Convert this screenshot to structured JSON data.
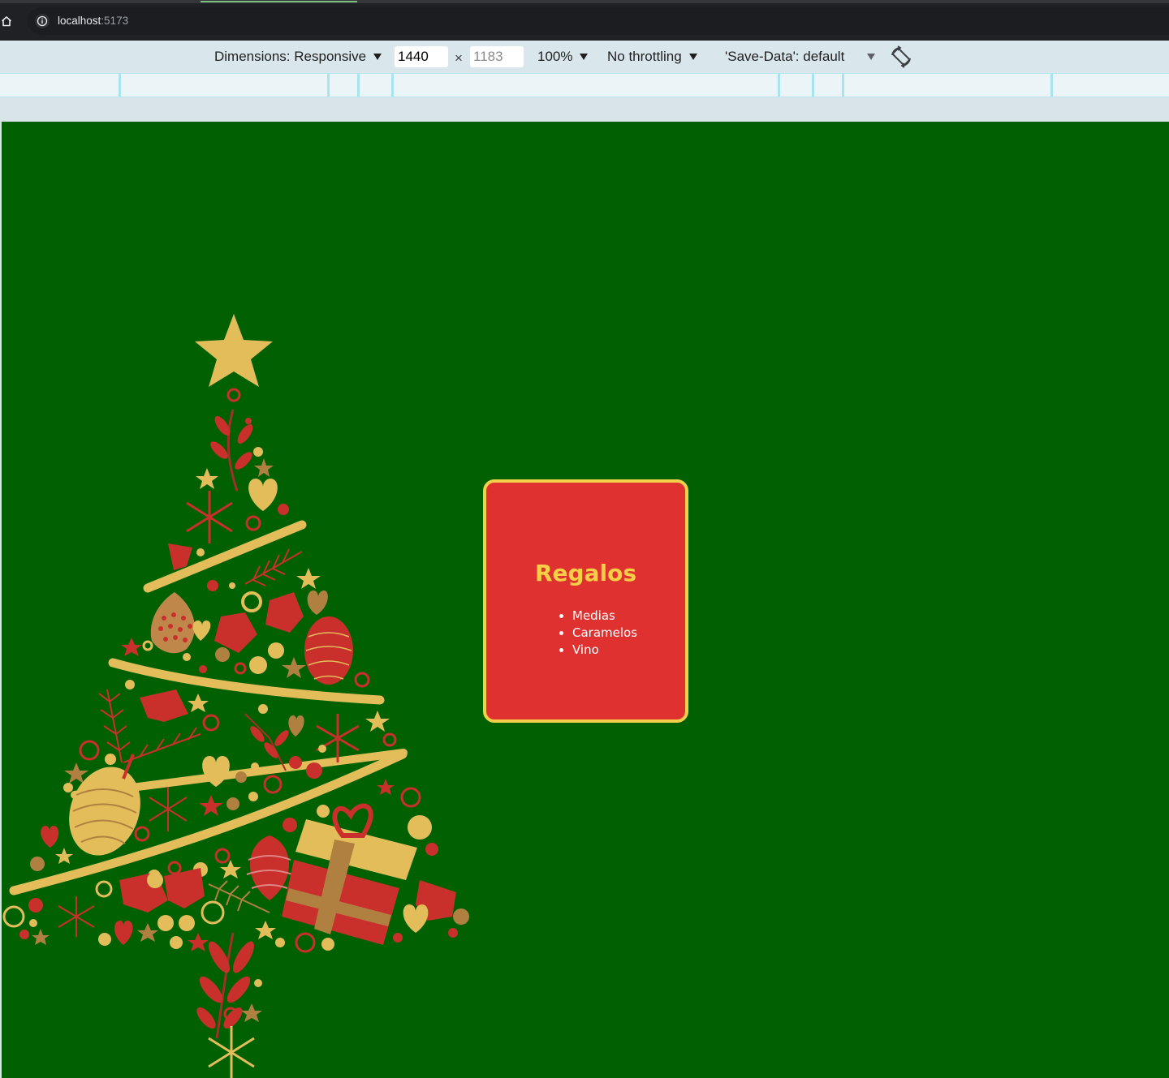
{
  "browser": {
    "url_host": "localhost",
    "url_port": ":5173"
  },
  "devtools": {
    "dimensions_label": "Dimensions: Responsive",
    "width_value": "1440",
    "height_placeholder": "1183",
    "times": "×",
    "zoom": "100%",
    "throttling": "No throttling",
    "save_data": "'Save-Data': default"
  },
  "card": {
    "title": "Regalos",
    "items": [
      "Medias",
      "Caramelos",
      "Vino"
    ]
  },
  "colors": {
    "page_background": "#016001",
    "card_background": "#e03131",
    "card_border": "#f3cf4a",
    "title": "#f5cf45",
    "tree_gold": "#e2bd5a",
    "tree_red": "#c9302c"
  },
  "icons": [
    "home-icon",
    "site-info-icon",
    "rotate-icon",
    "christmas-tree-illustration"
  ]
}
